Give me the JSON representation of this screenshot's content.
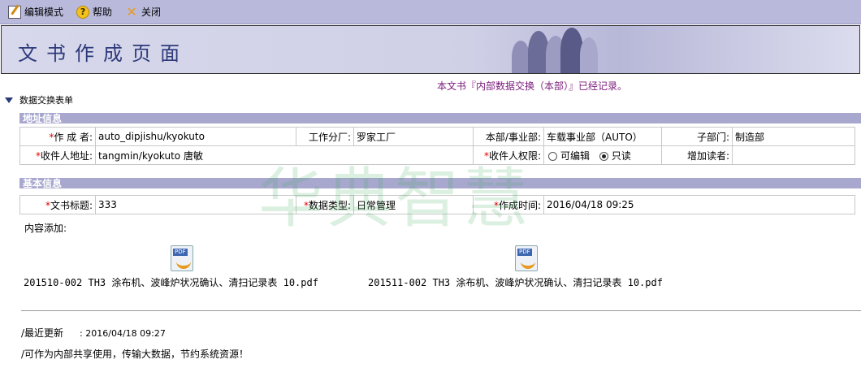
{
  "toolbar": {
    "edit_mode": "编辑模式",
    "help": "帮助",
    "close": "关闭"
  },
  "banner": {
    "title": "文书作成页面"
  },
  "status": {
    "prefix": "本文书『内部数据交换（本部）』",
    "suffix": "已经记录。"
  },
  "form_list_label": "数据交换表单",
  "address_section": {
    "title": "地址信息",
    "author_label": "作  成  者:",
    "author_value": "auto_dipjishu/kyokuto",
    "factory_label": "工作分厂:",
    "factory_value": "罗家工厂",
    "division_label": "本部/事业部:",
    "division_value": "车载事业部（AUTO）",
    "subdept_label": "子部门:",
    "subdept_value": "制造部",
    "recipient_label": "收件人地址:",
    "recipient_value": "tangmin/kyokuto 唐敏",
    "perm_label": "收件人权限:",
    "perm_options": [
      "可编辑",
      "只读"
    ],
    "perm_selected": "只读",
    "add_reader_label": "增加读者:",
    "add_reader_value": ""
  },
  "basic_section": {
    "title": "基本信息",
    "doc_title_label": "文书标题:",
    "doc_title_value": "333",
    "data_type_label": "数据类型:",
    "data_type_value": "日常管理",
    "created_label": "作成时间:",
    "created_value": "2016/04/18 09:25"
  },
  "content_label": "内容添加:",
  "attachments": [
    {
      "name": "201510-002 TH3 涂布机、波峰炉状况确认、清扫记录表 10.pdf",
      "icon": "pdf-file-icon",
      "badge": "PDF"
    },
    {
      "name": "201511-002 TH3 涂布机、波峰炉状况确认、清扫记录表 10.pdf",
      "icon": "pdf-file-icon",
      "badge": "PDF"
    }
  ],
  "last_updated_label": "/最近更新",
  "last_updated_value": ": 2016/04/18 09:27",
  "shared_note": "/可作为内部共享使用，传输大数据，节约系统资源！",
  "watermark": "华典智慧",
  "colors": {
    "toolbar": "#b9b9dc",
    "section_bar": "#a8a8cf",
    "required": "#e00000",
    "status_purple": "#7a1a7a",
    "banner_title": "#2d3a7a"
  }
}
